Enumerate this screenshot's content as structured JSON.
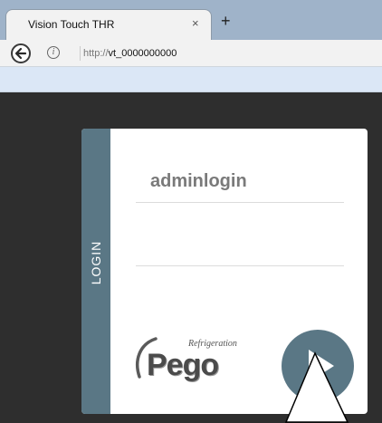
{
  "browser": {
    "tab_title": "Vision Touch THR",
    "close_glyph": "×",
    "new_tab_glyph": "+",
    "url_protocol": "http://",
    "url_host": "vt_0000000000",
    "info_glyph": "i"
  },
  "login": {
    "side_label": "LOGIN",
    "username_value": "adminlogin",
    "password_value": "",
    "logo_small": "Refrigeration",
    "logo_main": "Pego",
    "go_button_icon": "play-arrow-icon"
  },
  "colors": {
    "accent": "#5a7785",
    "page_background": "#2e2e2e",
    "card_background": "#ffffff"
  }
}
